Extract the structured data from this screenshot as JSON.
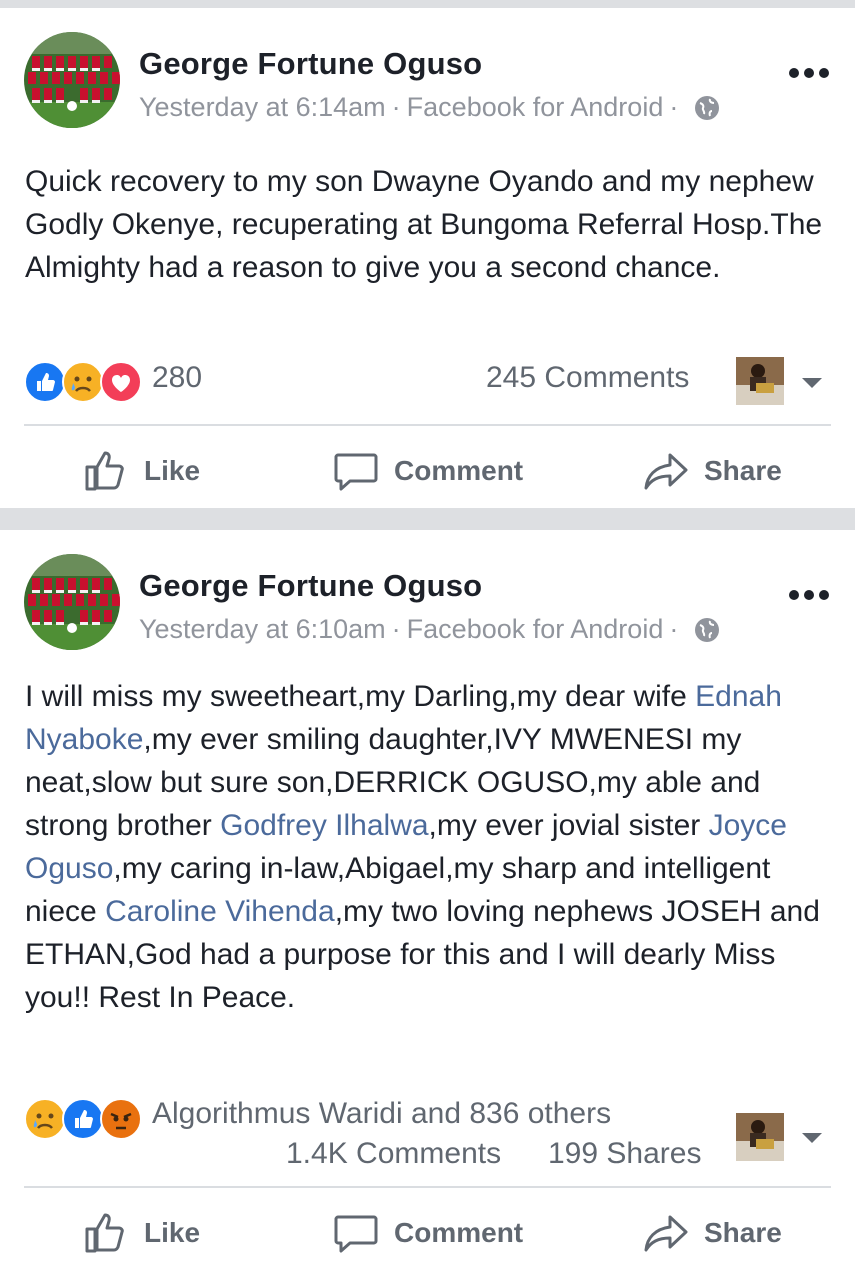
{
  "posts": [
    {
      "author": "George Fortune Oguso",
      "time": "Yesterday at 6:14am",
      "source": "Facebook for Android",
      "separator": "·",
      "text": "Quick recovery to my son Dwayne Oyando and my nephew Godly Okenye, recuperating at Bungoma Referral Hosp.The Almighty had a reason to give you a second chance.",
      "reaction_icons": [
        "like-icon",
        "sad-icon",
        "love-icon"
      ],
      "reaction_count": "280",
      "comments": "245 Comments",
      "actions": {
        "like": "Like",
        "comment": "Comment",
        "share": "Share"
      }
    },
    {
      "author": "George Fortune Oguso",
      "time": "Yesterday at 6:10am",
      "source": "Facebook for Android",
      "separator": "·",
      "text_segments": [
        {
          "text": "I will miss my sweetheart,my Darling,my dear wife ",
          "link": false
        },
        {
          "text": "Ednah Nyaboke",
          "link": true
        },
        {
          "text": ",my ever smiling daughter,IVY MWENESI my neat,slow but sure son,DERRICK OGUSO,my able and strong brother ",
          "link": false
        },
        {
          "text": "Godfrey Ilhalwa",
          "link": true
        },
        {
          "text": ",my ever jovial sister ",
          "link": false
        },
        {
          "text": "Joyce Oguso",
          "link": true
        },
        {
          "text": ",my caring in-law,Abigael,my sharp and intelligent niece ",
          "link": false
        },
        {
          "text": "Caroline Vihenda",
          "link": true
        },
        {
          "text": ",my two loving nephews JOSEH and ETHAN,God had a purpose for this and I will dearly Miss you!! Rest In Peace.",
          "link": false
        }
      ],
      "reaction_icons": [
        "sad-icon",
        "like-icon",
        "angry-icon"
      ],
      "reaction_summary": "Algorithmus Waridi and 836 others",
      "comments": "1.4K Comments",
      "shares": "199 Shares",
      "actions": {
        "like": "Like",
        "comment": "Comment",
        "share": "Share"
      }
    }
  ],
  "colors": {
    "link": "#4b6a9b",
    "secondary_text": "#90949c",
    "like_blue": "#1877f2",
    "love_red": "#f33e58",
    "sad_yellow": "#f7b125",
    "angry_orange": "#e9710f"
  }
}
